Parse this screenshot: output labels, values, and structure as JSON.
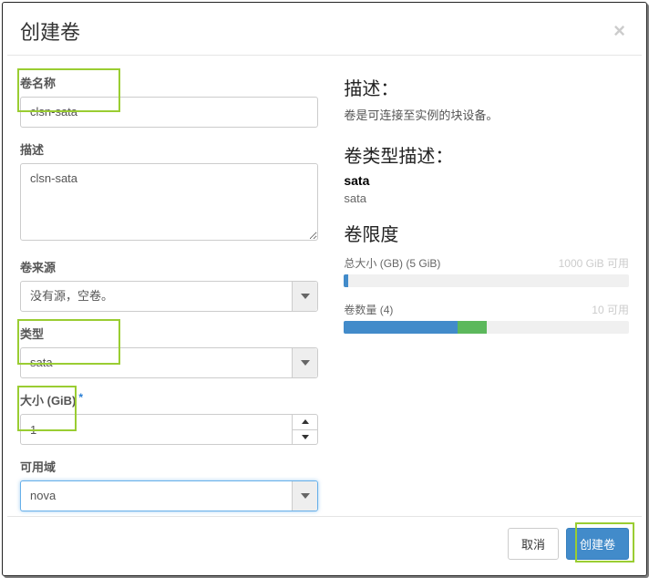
{
  "modal": {
    "title": "创建卷"
  },
  "form": {
    "name_label": "卷名称",
    "name_value": "clsn-sata",
    "desc_label": "描述",
    "desc_value": "clsn-sata",
    "source_label": "卷来源",
    "source_value": "没有源，空卷。",
    "type_label": "类型",
    "type_value": "sata",
    "size_label": "大小 (GiB)",
    "size_value": "1",
    "az_label": "可用域",
    "az_value": "nova"
  },
  "info": {
    "desc_heading": "描述：",
    "desc_text": "卷是可连接至实例的块设备。",
    "type_heading": "卷类型描述：",
    "type_name": "sata",
    "type_desc": "sata",
    "limits_heading": "卷限度",
    "size_quota_label": "总大小 (GB) (5 GiB)",
    "size_quota_avail": "1000 GiB 可用",
    "count_quota_label": "卷数量 (4)",
    "count_quota_avail": "10 可用"
  },
  "footer": {
    "cancel": "取消",
    "submit": "创建卷"
  }
}
